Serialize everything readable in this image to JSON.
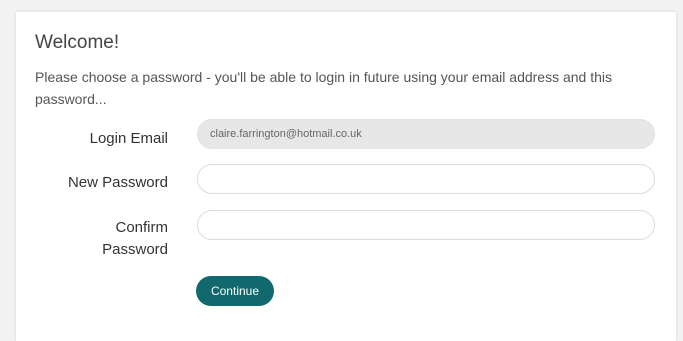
{
  "welcome": {
    "title": "Welcome!",
    "intro": "Please choose a password - you'll be able to login in future using your email address and this password..."
  },
  "form": {
    "login_email_label": "Login Email",
    "login_email_value": "claire.farrington@hotmail.co.uk",
    "new_password_label": "New Password",
    "new_password_value": "",
    "confirm_password_label_line1": "Confirm",
    "confirm_password_label_line2": "Password",
    "confirm_password_value": "",
    "continue_label": "Continue"
  },
  "colors": {
    "accent": "#12696d",
    "disabled_field": "#e7e7e7"
  }
}
